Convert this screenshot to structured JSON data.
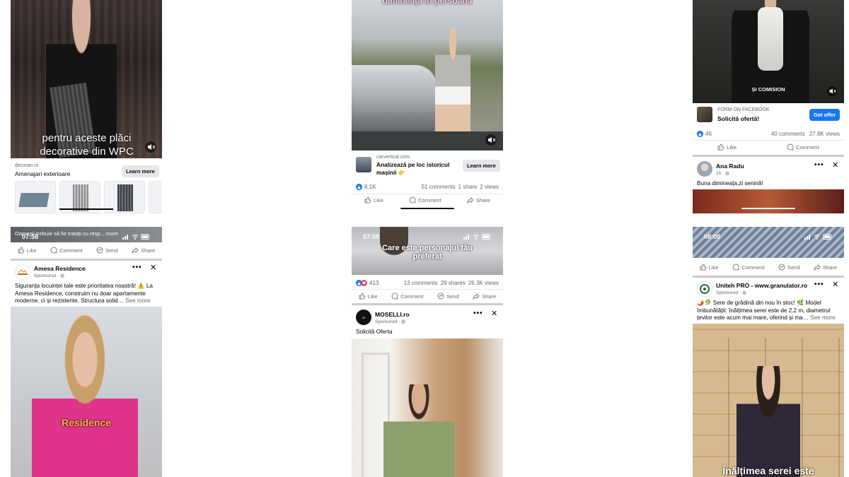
{
  "col1_top": {
    "caption": "pentru aceste plăci decorative din WPC",
    "domain": "decoran.ro",
    "headline": "Amenajari exterioare",
    "cta": "Learn more"
  },
  "col1_bottom": {
    "overlay_text": "Oamenii trebuie să fie tratați cu resp... more",
    "time": "07:58",
    "actions": {
      "like": "Like",
      "comment": "Comment",
      "send": "Send",
      "share": "Share"
    },
    "page_name": "Amesa Residence",
    "sponsored": "Sponsored ·",
    "body": "Siguranța locuinței tale este prioritatea noastră! ⚠️ La Amesa Residence, construim nu doar apartamente moderne, ci și rezistente. Structura solid…",
    "see_more": "See more",
    "video_caption": "Residence"
  },
  "col2_top": {
    "caption": "dimineața în persoană",
    "domain": "carvertical.com",
    "headline": "Analizează pe loc istoricul mașinii 👉",
    "cta": "Learn more",
    "reactions": "8.1K",
    "comments": "51 comments",
    "shares": "1 share",
    "views": "2 views",
    "actions": {
      "like": "Like",
      "comment": "Comment",
      "share": "Share"
    }
  },
  "col2_bottom": {
    "time": "07:59",
    "caption": "Care este personajul tău preferat",
    "reactions": "413",
    "comments": "13 comments",
    "shares": "29 shares",
    "views": "26.3K views",
    "actions": {
      "like": "Like",
      "comment": "Comment",
      "send": "Send",
      "share": "Share"
    },
    "page_name": "MOSELLI.ro",
    "sponsored": "Sponsored ·",
    "body": "Solicită Oferta"
  },
  "col3_top": {
    "caption": "ȘI COMISION",
    "form_label": "FORM ON FACEBOOK",
    "form_title": "Solicită ofertă!",
    "cta": "Get offer",
    "reactions": "46",
    "comments": "40 comments",
    "views": "27.8K views",
    "actions": {
      "like": "Like",
      "comment": "Comment"
    },
    "author": "Ana Radu",
    "meta": "1h ·",
    "body": "Buna dimineața,zi senină!"
  },
  "col3_bottom": {
    "time": "08:00",
    "actions": {
      "like": "Like",
      "comment": "Comment",
      "send": "Send",
      "share": "Share"
    },
    "page_name": "Uniteh PRO - www.granulator.ro",
    "sponsored": "Sponsored ·",
    "body": "🌶️🥬 Sere de grădină din nou în stoc! 🌿 Model îmbunătățit: înălțimea serei este de 2.2 m, diametrul țevilor este acum mai mare, oferind și ma…",
    "see_more": "See more",
    "video_caption": "Înălțimea serei este"
  },
  "colors": {
    "fb_blue": "#1877f2",
    "ui_grey": "#65676b",
    "divider": "#e4e6eb"
  }
}
